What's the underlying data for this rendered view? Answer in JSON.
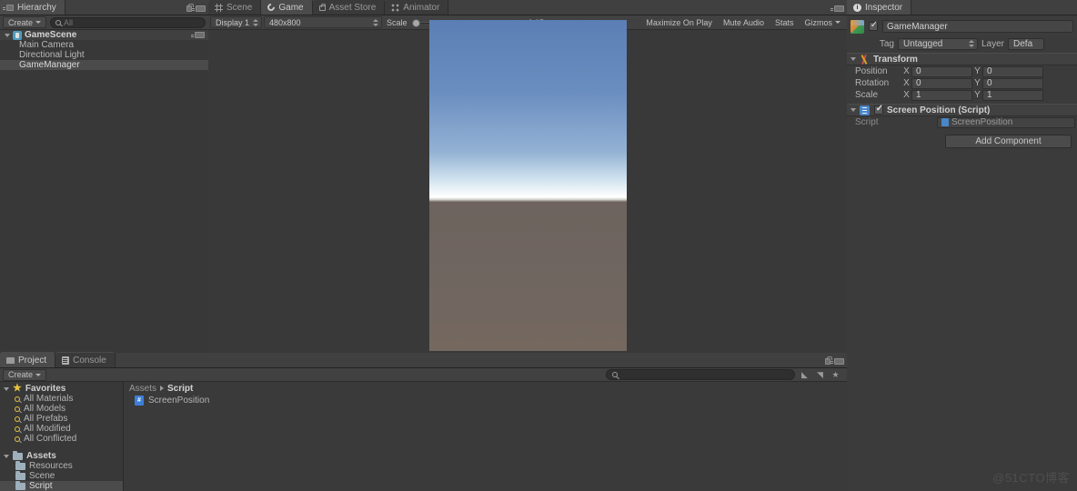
{
  "hierarchy": {
    "tab_label": "Hierarchy",
    "tab_icon": "hierarchy-icon",
    "lock_icon": "lock-icon",
    "menu_icon": "panel-menu-icon",
    "create_label": "Create",
    "search_placeholder": "All",
    "search_icon": "search-icon",
    "items": [
      {
        "label": "GameScene",
        "icon": "scene-icon",
        "depth": 0,
        "selected": false,
        "root": true
      },
      {
        "label": "Main Camera",
        "icon": "",
        "depth": 1,
        "selected": false,
        "root": false
      },
      {
        "label": "Directional Light",
        "icon": "",
        "depth": 1,
        "selected": false,
        "root": false
      },
      {
        "label": "GameManager",
        "icon": "",
        "depth": 1,
        "selected": true,
        "root": false
      }
    ]
  },
  "center": {
    "tabs": [
      {
        "label": "Scene",
        "icon": "grid-icon",
        "active": false
      },
      {
        "label": "Game",
        "icon": "gamepad-icon",
        "active": true
      },
      {
        "label": "Asset Store",
        "icon": "store-icon",
        "active": false
      },
      {
        "label": "Animator",
        "icon": "animator-icon",
        "active": false
      }
    ],
    "menu_icon": "panel-menu-icon",
    "toolbar": {
      "display": "Display 1",
      "resolution": "480x800",
      "scale_label": "Scale",
      "scale_value": "0.65:",
      "maximize_on_play": "Maximize On Play",
      "mute_audio": "Mute Audio",
      "stats": "Stats",
      "gizmos": "Gizmos"
    }
  },
  "inspector": {
    "tab_label": "Inspector",
    "tab_icon": "inspector-icon",
    "object_name": "GameManager",
    "object_enabled": true,
    "object_icon": "gameobject-cube-icon",
    "tag_label": "Tag",
    "tag_value": "Untagged",
    "layer_label": "Layer",
    "layer_value": "Defa",
    "components": [
      {
        "title": "Transform",
        "icon": "transform-icon",
        "rows": [
          {
            "label": "Position",
            "x": "0",
            "y": "0"
          },
          {
            "label": "Rotation",
            "x": "0",
            "y": "0"
          },
          {
            "label": "Scale",
            "x": "1",
            "y": "1"
          }
        ]
      },
      {
        "title": "Screen Position (Script)",
        "icon": "script-icon",
        "enabled": true,
        "script_label": "Script",
        "script_value": "ScreenPosition"
      }
    ],
    "add_component_label": "Add Component"
  },
  "project": {
    "tabs": [
      {
        "label": "Project",
        "icon": "project-icon",
        "active": true
      },
      {
        "label": "Console",
        "icon": "console-icon",
        "active": false
      }
    ],
    "create_label": "Create",
    "search_placeholder": "",
    "search_icon": "search-icon",
    "filter_icons": [
      "filter-by-type-icon",
      "filter-by-label-icon",
      "filter-favorites-icon"
    ],
    "tree": [
      {
        "label": "Favorites",
        "icon": "star-icon",
        "depth": 0,
        "header": true,
        "selected": false
      },
      {
        "label": "All Materials",
        "icon": "search-icon",
        "depth": 1,
        "header": false,
        "selected": false
      },
      {
        "label": "All Models",
        "icon": "search-icon",
        "depth": 1,
        "header": false,
        "selected": false
      },
      {
        "label": "All Prefabs",
        "icon": "search-icon",
        "depth": 1,
        "header": false,
        "selected": false
      },
      {
        "label": "All Modified",
        "icon": "search-icon",
        "depth": 1,
        "header": false,
        "selected": false
      },
      {
        "label": "All Conflicted",
        "icon": "search-icon",
        "depth": 1,
        "header": false,
        "selected": false
      },
      {
        "label": "Assets",
        "icon": "folder-icon",
        "depth": 0,
        "header": true,
        "selected": false
      },
      {
        "label": "Resources",
        "icon": "folder-icon",
        "depth": 1,
        "header": false,
        "selected": false
      },
      {
        "label": "Scene",
        "icon": "folder-icon",
        "depth": 1,
        "header": false,
        "selected": false
      },
      {
        "label": "Script",
        "icon": "folder-icon",
        "depth": 1,
        "header": false,
        "selected": true
      }
    ],
    "breadcrumb": {
      "root": "Assets",
      "current": "Script"
    },
    "assets": [
      {
        "label": "ScreenPosition",
        "icon": "csharp-script-icon"
      }
    ]
  },
  "watermark": "@51CTO博客",
  "colors": {
    "panel_bg": "#383838",
    "toolbar_bg": "#414141",
    "selection": "#4b4b4b",
    "text": "#b4b4b4",
    "sky_top": "#5b7eb4",
    "sky_horizon": "#ffffff",
    "ground": "#6e635d",
    "script_blue": "#4a86c8",
    "favorite_yellow": "#e8c33a"
  }
}
